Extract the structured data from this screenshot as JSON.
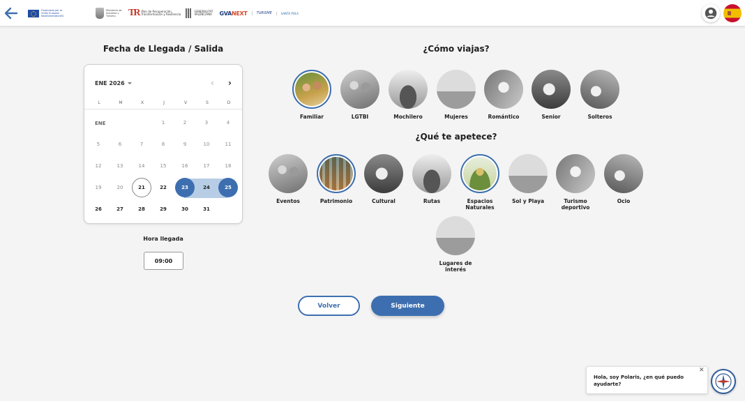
{
  "header": {
    "logos": {
      "eu": "Financiado por la Unión Europea NextGenerationEU",
      "ministerio": "Ministerio de Industria y Turismo",
      "tr_mark": "TR",
      "tr": "Plan de Recuperación, Transformación y Resiliencia",
      "gv": "GENERALITAT VALENCIANA",
      "gvanext_a": "GVA",
      "gvanext_b": "NEXT",
      "turisme": "TURISME",
      "santapola": "SANTA POLA"
    }
  },
  "dates": {
    "title": "Fecha de Llegada / Salida",
    "calendar": {
      "month_label": "ENE 2026",
      "weekdays": [
        "L",
        "M",
        "X",
        "J",
        "V",
        "S",
        "D"
      ],
      "row_label": "ENE",
      "days": [
        "1",
        "2",
        "3",
        "4",
        "5",
        "6",
        "7",
        "8",
        "9",
        "10",
        "11",
        "12",
        "13",
        "14",
        "15",
        "16",
        "17",
        "18",
        "19",
        "20",
        "21",
        "22",
        "23",
        "24",
        "25",
        "26",
        "27",
        "28",
        "29",
        "30",
        "31"
      ]
    },
    "hora_label": "Hora llegada",
    "hora_value": "09:00"
  },
  "travel": {
    "title": "¿Cómo viajas?",
    "options": [
      {
        "label": "Familiar",
        "selected": true
      },
      {
        "label": "LGTBI"
      },
      {
        "label": "Mochilero"
      },
      {
        "label": "Mujeres"
      },
      {
        "label": "Romántico"
      },
      {
        "label": "Senior"
      },
      {
        "label": "Solteros"
      }
    ]
  },
  "interests": {
    "title": "¿Qué te apetece?",
    "options": [
      {
        "label": "Eventos"
      },
      {
        "label": "Patrimonio",
        "selected": true
      },
      {
        "label": "Cultural"
      },
      {
        "label": "Rutas"
      },
      {
        "label": "Espacios Naturales",
        "selected": true
      },
      {
        "label": "Sol y Playa"
      },
      {
        "label": "Turismo deportivo"
      },
      {
        "label": "Ocio"
      },
      {
        "label": "Lugares de interés"
      }
    ]
  },
  "actions": {
    "back": "Volver",
    "next": "Siguiente"
  },
  "chat": {
    "message": "Hola, soy Polaris, ¿en qué puedo ayudarte?",
    "close": "✕"
  },
  "colors": {
    "accent": "#3d6fb0",
    "range": "#b7cde6"
  }
}
